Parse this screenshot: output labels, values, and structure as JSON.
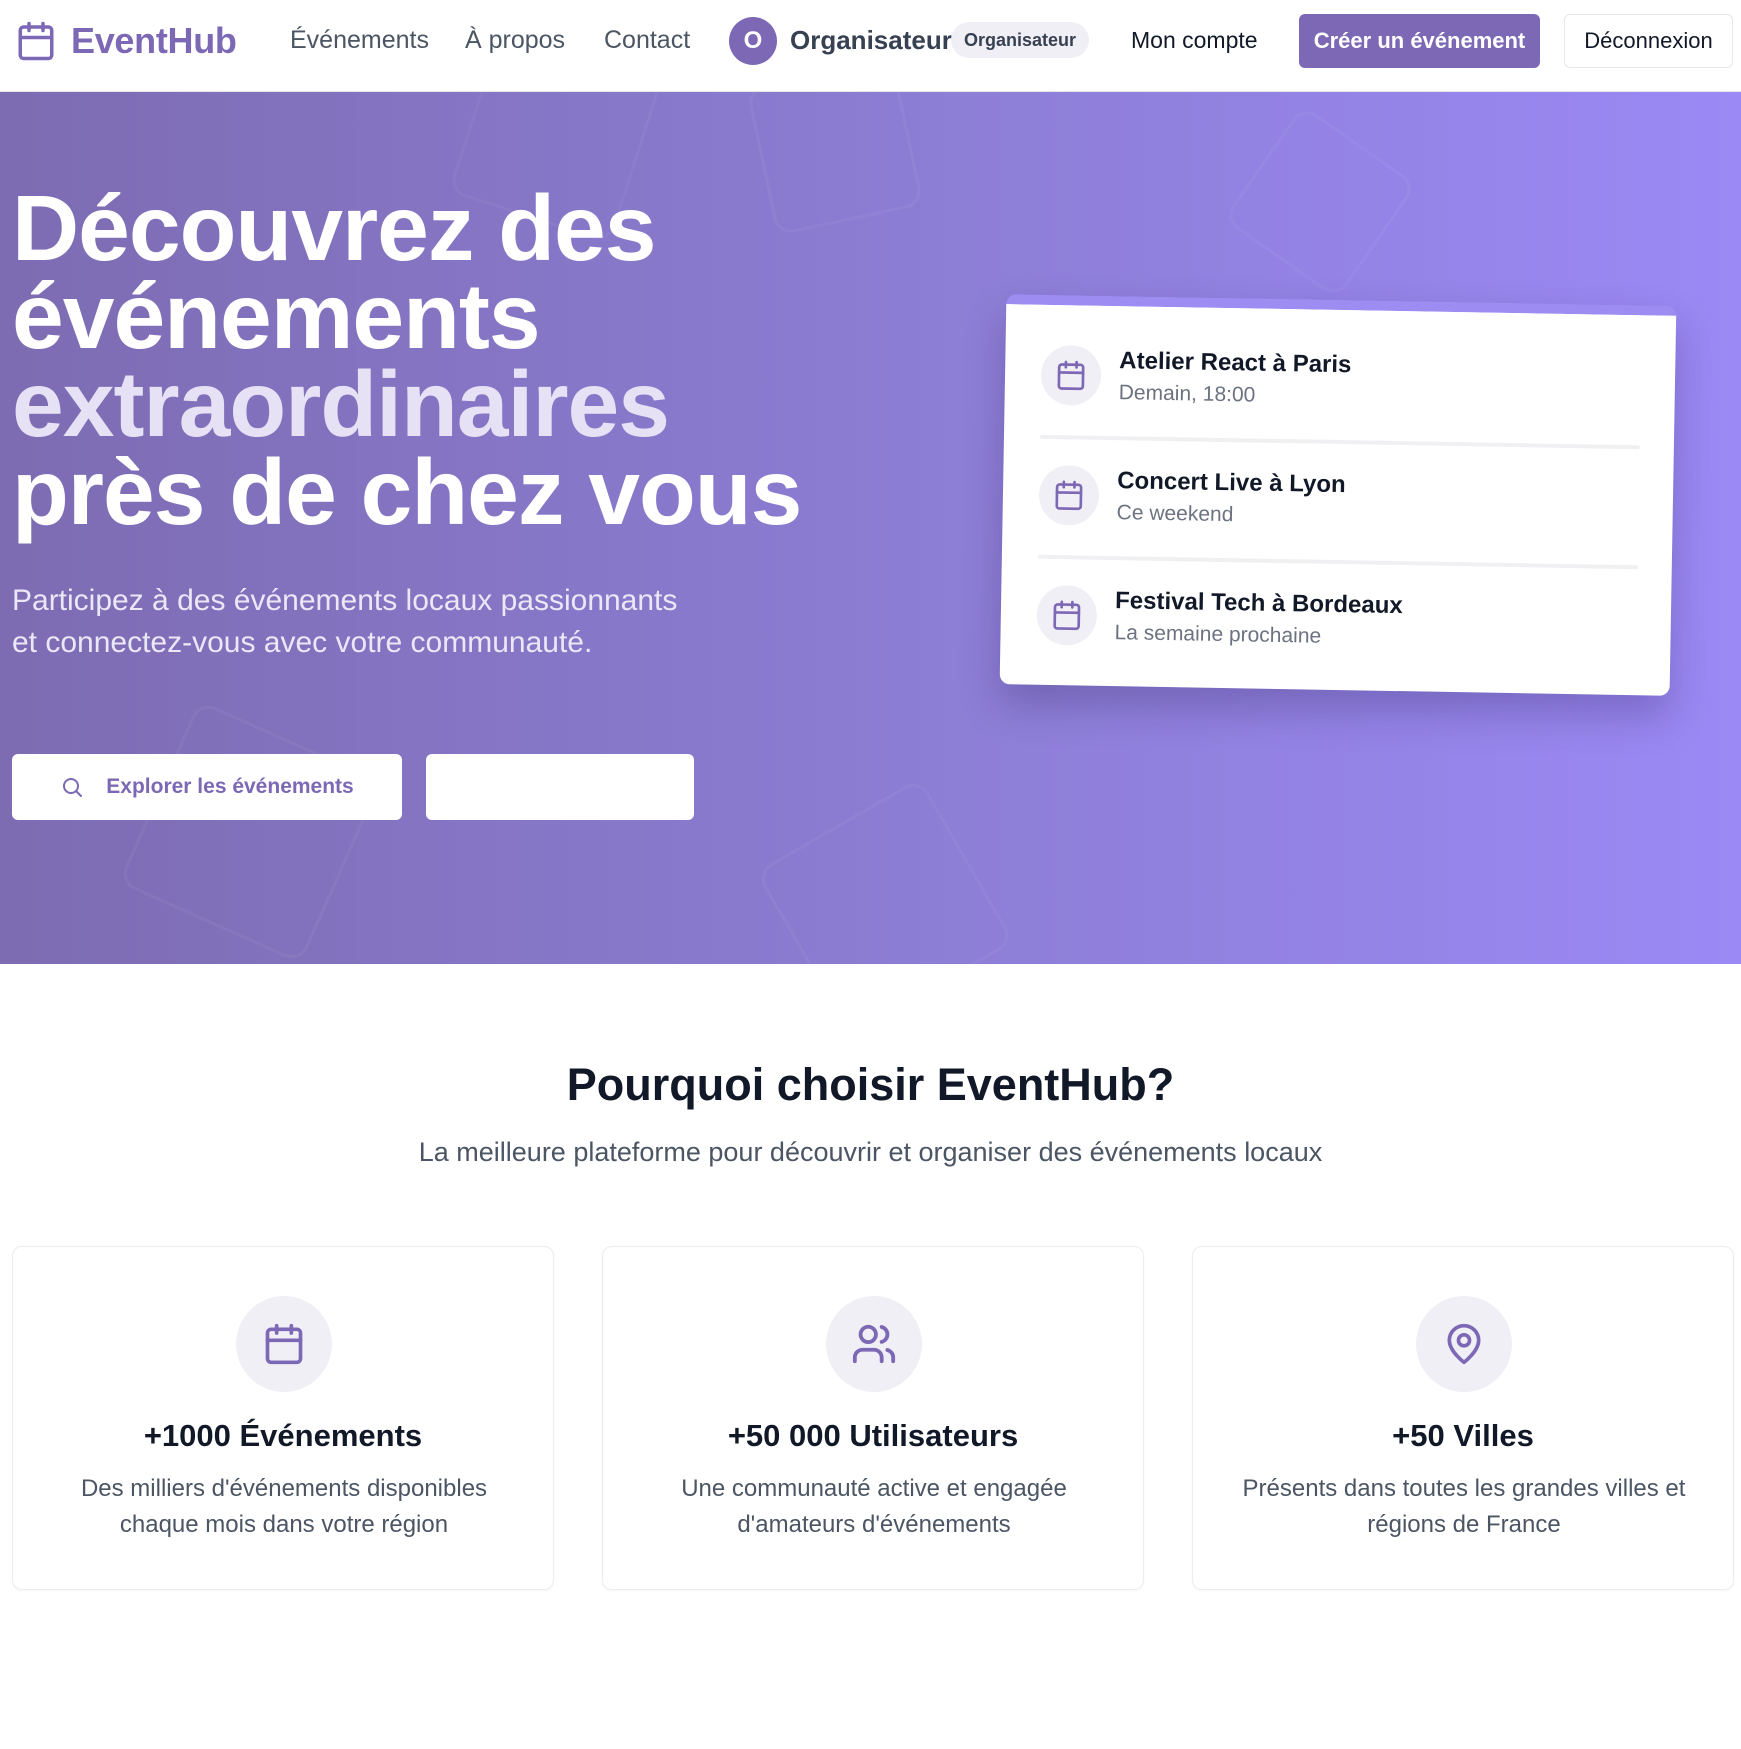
{
  "header": {
    "logo_text": "EventHub",
    "nav": [
      "Événements",
      "À propos",
      "Contact"
    ],
    "user": {
      "initial": "O",
      "name": "Organisateur",
      "role_badge": "Organisateur"
    },
    "account_link": "Mon compte",
    "create_button": "Créer un événement",
    "logout_button": "Déconnexion"
  },
  "hero": {
    "title_line1": "Découvrez des",
    "title_line2": "événements",
    "title_accent": "extraordinaires",
    "title_line4": "près de chez vous",
    "subtitle": "Participez à des événements locaux passionnants et connectez-vous avec votre communauté.",
    "explore_button": "Explorer les événements",
    "secondary_button": "",
    "events": [
      {
        "title": "Atelier React à Paris",
        "time": "Demain, 18:00"
      },
      {
        "title": "Concert Live à Lyon",
        "time": "Ce weekend"
      },
      {
        "title": "Festival Tech à Bordeaux",
        "time": "La semaine prochaine"
      }
    ]
  },
  "why": {
    "title": "Pourquoi choisir EventHub?",
    "subtitle": "La meilleure plateforme pour découvrir et organiser des événements locaux",
    "features": [
      {
        "icon": "calendar-icon",
        "title": "+1000 Événements",
        "desc": "Des milliers d'événements disponibles chaque mois dans votre région"
      },
      {
        "icon": "users-icon",
        "title": "+50 000 Utilisateurs",
        "desc": "Une communauté active et engagée d'amateurs d'événements"
      },
      {
        "icon": "map-pin-icon",
        "title": "+50 Villes",
        "desc": "Présents dans toutes les grandes villes et régions de France"
      }
    ]
  },
  "colors": {
    "brand": "#7c68b4",
    "hero_gradient_start": "#7d6cb2",
    "hero_gradient_end": "#9b89f5"
  }
}
